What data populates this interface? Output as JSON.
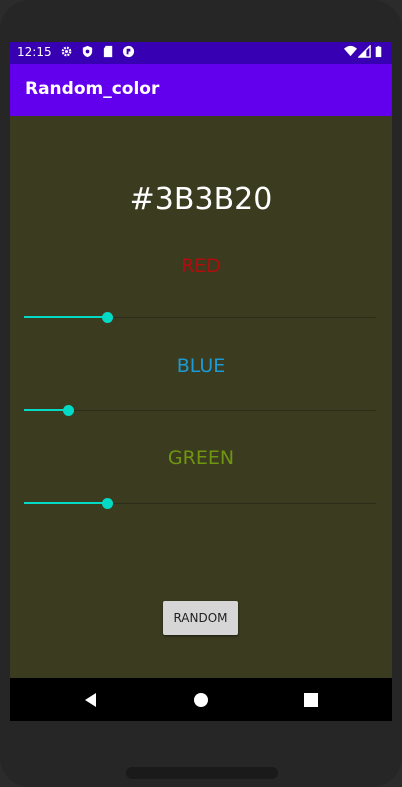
{
  "statusbar": {
    "time": "12:15"
  },
  "appbar": {
    "title": "Random_color"
  },
  "main": {
    "hex": "#3B3B20",
    "background_color": "#3B3B20",
    "red": {
      "label": "RED",
      "color": "#b00d0d",
      "value": 0.235
    },
    "blue": {
      "label": "BLUE",
      "color": "#1a9bd6",
      "value": 0.125
    },
    "green": {
      "label": "GREEN",
      "color": "#6f9611",
      "value": 0.235
    },
    "button_label": "RANDOM"
  },
  "icons": {
    "status": [
      "gear-icon",
      "shield-icon",
      "sd-card-icon",
      "notification-icon",
      "wifi-icon",
      "signal-icon",
      "battery-icon"
    ],
    "nav": [
      "back-icon",
      "home-icon",
      "recents-icon"
    ]
  }
}
